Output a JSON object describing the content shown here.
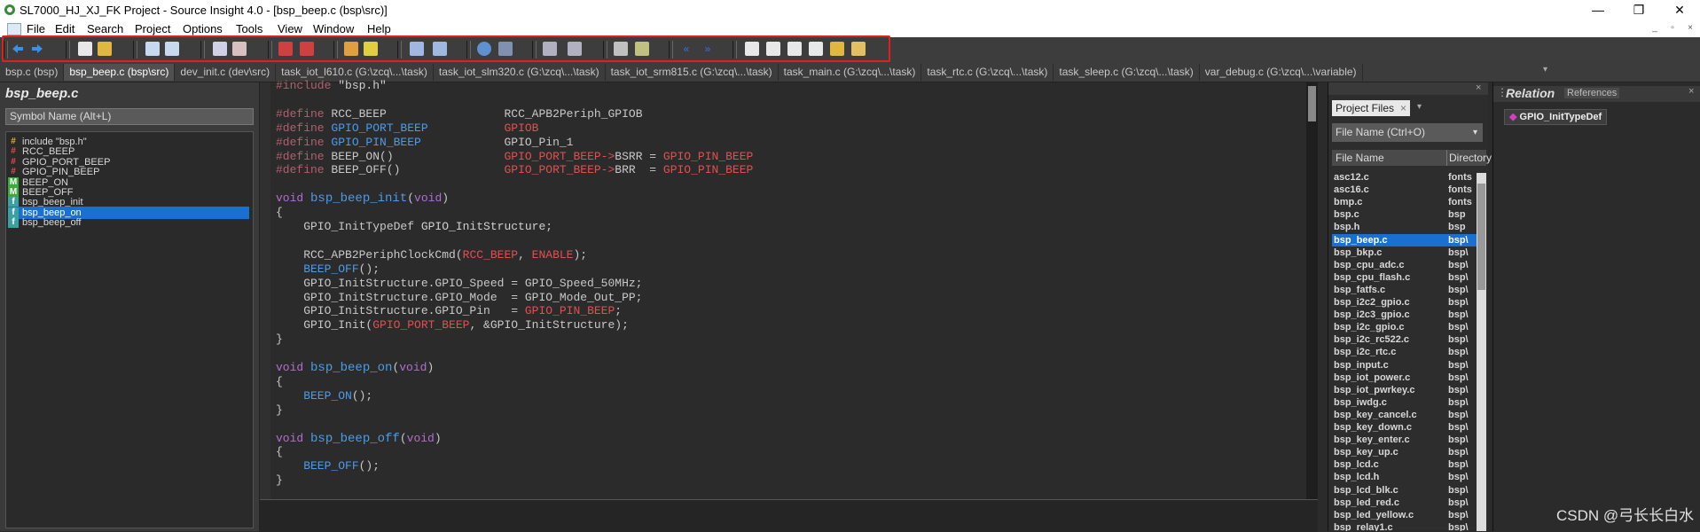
{
  "window": {
    "title": "SL7000_HJ_XJ_FK Project - Source Insight 4.0 - [bsp_beep.c (bsp\\src)]",
    "minimize_glyph": "—",
    "restore_glyph": "❐",
    "close_glyph": "✕"
  },
  "menu": [
    "File",
    "Edit",
    "Search",
    "Project",
    "Options",
    "Tools",
    "View",
    "Window",
    "Help"
  ],
  "tabs": [
    {
      "label": "bsp.c (bsp)",
      "active": false
    },
    {
      "label": "bsp_beep.c (bsp\\src)",
      "active": true
    },
    {
      "label": "dev_init.c (dev\\src)",
      "active": false
    },
    {
      "label": "task_iot_l610.c (G:\\zcq\\...\\task)",
      "active": false
    },
    {
      "label": "task_iot_slm320.c (G:\\zcq\\...\\task)",
      "active": false
    },
    {
      "label": "task_iot_srm815.c (G:\\zcq\\...\\task)",
      "active": false
    },
    {
      "label": "task_main.c (G:\\zcq\\...\\task)",
      "active": false
    },
    {
      "label": "task_rtc.c (G:\\zcq\\...\\task)",
      "active": false
    },
    {
      "label": "task_sleep.c (G:\\zcq\\...\\task)",
      "active": false
    },
    {
      "label": "var_debug.c (G:\\zcq\\...\\variable)",
      "active": false
    }
  ],
  "symbol_panel": {
    "title": "bsp_beep.c",
    "search_placeholder": "Symbol Name (Alt+L)",
    "symbols": [
      {
        "label": "include \"bsp.h\"",
        "icon": "include-icon",
        "selected": false
      },
      {
        "label": "RCC_BEEP",
        "icon": "define-icon",
        "selected": false
      },
      {
        "label": "GPIO_PORT_BEEP",
        "icon": "define-icon",
        "selected": false
      },
      {
        "label": "GPIO_PIN_BEEP",
        "icon": "define-icon",
        "selected": false
      },
      {
        "label": "BEEP_ON",
        "icon": "macro-icon",
        "selected": false
      },
      {
        "label": "BEEP_OFF",
        "icon": "macro-icon",
        "selected": false
      },
      {
        "label": "bsp_beep_init",
        "icon": "function-icon",
        "selected": false
      },
      {
        "label": "bsp_beep_on",
        "icon": "function-icon",
        "selected": true
      },
      {
        "label": "bsp_beep_off",
        "icon": "function-icon",
        "selected": false
      }
    ]
  },
  "code_lines": [
    [
      [
        "pp",
        "#include "
      ],
      [
        "str",
        "\"bsp.h\""
      ]
    ],
    [],
    [
      [
        "pp",
        "#define "
      ],
      [
        "",
        "RCC_BEEP                 "
      ],
      [
        "",
        "RCC_APB2Periph_GPIOB"
      ]
    ],
    [
      [
        "pp",
        "#define "
      ],
      [
        "mac",
        "GPIO_PORT_BEEP           "
      ],
      [
        "con",
        "GPIOB"
      ]
    ],
    [
      [
        "pp",
        "#define "
      ],
      [
        "mac",
        "GPIO_PIN_BEEP            "
      ],
      [
        "",
        "GPIO_Pin_1"
      ]
    ],
    [
      [
        "pp",
        "#define "
      ],
      [
        "",
        "BEEP_ON()                "
      ],
      [
        "con",
        "GPIO_PORT_BEEP->"
      ],
      [
        "",
        "BSRR = "
      ],
      [
        "con",
        "GPIO_PIN_BEEP"
      ]
    ],
    [
      [
        "pp",
        "#define "
      ],
      [
        "",
        "BEEP_OFF()               "
      ],
      [
        "con",
        "GPIO_PORT_BEEP->"
      ],
      [
        "",
        "BRR  = "
      ],
      [
        "con",
        "GPIO_PIN_BEEP"
      ]
    ],
    [],
    [
      [
        "kw",
        "void "
      ],
      [
        "fnm",
        "bsp_beep_init"
      ],
      [
        "",
        "("
      ],
      [
        "kw",
        "void"
      ],
      [
        "",
        ")"
      ]
    ],
    [
      [
        "",
        "{"
      ]
    ],
    [
      [
        "",
        "    GPIO_InitTypeDef "
      ],
      [
        "str",
        "GPIO_InitStructure"
      ],
      [
        "",
        ";"
      ]
    ],
    [],
    [
      [
        "",
        "    RCC_APB2PeriphClockCmd("
      ],
      [
        "con",
        "RCC_BEEP"
      ],
      [
        "",
        ", "
      ],
      [
        "con",
        "ENABLE"
      ],
      [
        "",
        ");"
      ]
    ],
    [
      [
        "mac",
        "    BEEP_OFF"
      ],
      [
        "",
        "();"
      ]
    ],
    [
      [
        "",
        "    GPIO_InitStructure.GPIO_Speed = GPIO_Speed_50MHz;"
      ]
    ],
    [
      [
        "",
        "    GPIO_InitStructure.GPIO_Mode  = GPIO_Mode_Out_PP;"
      ]
    ],
    [
      [
        "",
        "    GPIO_InitStructure.GPIO_Pin   = "
      ],
      [
        "con",
        "GPIO_PIN_BEEP"
      ],
      [
        "",
        ";"
      ]
    ],
    [
      [
        "",
        "    GPIO_Init("
      ],
      [
        "con",
        "GPIO_PORT_BEEP"
      ],
      [
        "",
        ", &GPIO_InitStructure);"
      ]
    ],
    [
      [
        "",
        "}"
      ]
    ],
    [],
    [
      [
        "kw",
        "void "
      ],
      [
        "fnm",
        "bsp_beep_on"
      ],
      [
        "",
        "("
      ],
      [
        "kw",
        "void"
      ],
      [
        "",
        ")"
      ]
    ],
    [
      [
        "",
        "{"
      ]
    ],
    [
      [
        "mac",
        "    BEEP_ON"
      ],
      [
        "",
        "();"
      ]
    ],
    [
      [
        "",
        "}"
      ]
    ],
    [],
    [
      [
        "kw",
        "void "
      ],
      [
        "fnm",
        "bsp_beep_off"
      ],
      [
        "",
        "("
      ],
      [
        "kw",
        "void"
      ],
      [
        "",
        ")"
      ]
    ],
    [
      [
        "",
        "{"
      ]
    ],
    [
      [
        "mac",
        "    BEEP_OFF"
      ],
      [
        "",
        "();"
      ]
    ],
    [
      [
        "",
        "}"
      ]
    ]
  ],
  "project_panel": {
    "tab_label": "Project Files",
    "search_placeholder": "File Name (Ctrl+O)",
    "col_name": "File Name",
    "col_dir": "Directory",
    "files": [
      {
        "name": "asc12.c",
        "dir": "fonts",
        "selected": false
      },
      {
        "name": "asc16.c",
        "dir": "fonts",
        "selected": false
      },
      {
        "name": "bmp.c",
        "dir": "fonts",
        "selected": false
      },
      {
        "name": "bsp.c",
        "dir": "bsp",
        "selected": false
      },
      {
        "name": "bsp.h",
        "dir": "bsp",
        "selected": false
      },
      {
        "name": "bsp_beep.c",
        "dir": "bsp\\",
        "selected": true
      },
      {
        "name": "bsp_bkp.c",
        "dir": "bsp\\",
        "selected": false
      },
      {
        "name": "bsp_cpu_adc.c",
        "dir": "bsp\\",
        "selected": false
      },
      {
        "name": "bsp_cpu_flash.c",
        "dir": "bsp\\",
        "selected": false
      },
      {
        "name": "bsp_fatfs.c",
        "dir": "bsp\\",
        "selected": false
      },
      {
        "name": "bsp_i2c2_gpio.c",
        "dir": "bsp\\",
        "selected": false
      },
      {
        "name": "bsp_i2c3_gpio.c",
        "dir": "bsp\\",
        "selected": false
      },
      {
        "name": "bsp_i2c_gpio.c",
        "dir": "bsp\\",
        "selected": false
      },
      {
        "name": "bsp_i2c_rc522.c",
        "dir": "bsp\\",
        "selected": false
      },
      {
        "name": "bsp_i2c_rtc.c",
        "dir": "bsp\\",
        "selected": false
      },
      {
        "name": "bsp_input.c",
        "dir": "bsp\\",
        "selected": false
      },
      {
        "name": "bsp_iot_power.c",
        "dir": "bsp\\",
        "selected": false
      },
      {
        "name": "bsp_iot_pwrkey.c",
        "dir": "bsp\\",
        "selected": false
      },
      {
        "name": "bsp_iwdg.c",
        "dir": "bsp\\",
        "selected": false
      },
      {
        "name": "bsp_key_cancel.c",
        "dir": "bsp\\",
        "selected": false
      },
      {
        "name": "bsp_key_down.c",
        "dir": "bsp\\",
        "selected": false
      },
      {
        "name": "bsp_key_enter.c",
        "dir": "bsp\\",
        "selected": false
      },
      {
        "name": "bsp_key_up.c",
        "dir": "bsp\\",
        "selected": false
      },
      {
        "name": "bsp_lcd.c",
        "dir": "bsp\\",
        "selected": false
      },
      {
        "name": "bsp_lcd.h",
        "dir": "bsp\\",
        "selected": false
      },
      {
        "name": "bsp_lcd_blk.c",
        "dir": "bsp\\",
        "selected": false
      },
      {
        "name": "bsp_led_red.c",
        "dir": "bsp\\",
        "selected": false
      },
      {
        "name": "bsp_led_yellow.c",
        "dir": "bsp\\",
        "selected": false
      },
      {
        "name": "bsp_relay1.c",
        "dir": "bsp\\",
        "selected": false
      }
    ]
  },
  "relation_panel": {
    "title": "Relation",
    "references_label": "References",
    "node_label": "GPIO_InitTypeDef"
  },
  "watermark": "CSDN @弓长长白水",
  "colors": {
    "selection": "#1a70d0",
    "highlight_box": "#e02020",
    "keyword": "#b070d0",
    "macro": "#4d9be8",
    "constant": "#e05050"
  }
}
